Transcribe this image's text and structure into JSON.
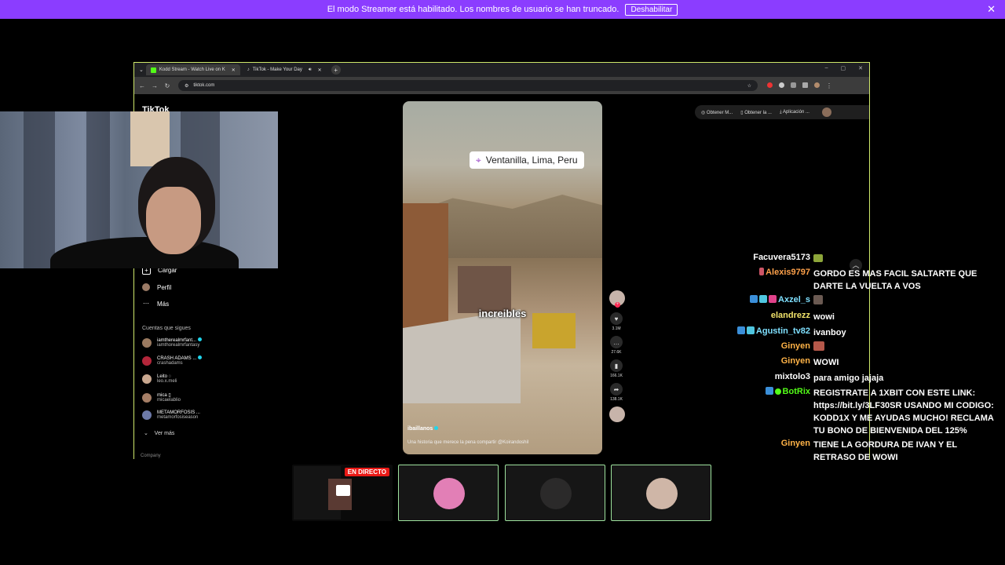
{
  "banner": {
    "text": "El modo Streamer está habilitado. Los nombres de usuario se han truncado.",
    "button": "Deshabilitar"
  },
  "browser": {
    "tabs": [
      {
        "label": "Kodd Stream - Watch Live on K",
        "favicon_color": "#53fc18"
      },
      {
        "label": "TikTok - Make Your Day",
        "favicon_color": "#ffffff"
      }
    ],
    "url": "tiktok.com"
  },
  "tiktok": {
    "logo": "TikTok",
    "menu": [
      {
        "label": "Cargar",
        "icon": "plus-square-icon"
      },
      {
        "label": "Perfil",
        "icon": "avatar-icon"
      },
      {
        "label": "Más",
        "icon": "more-icon"
      }
    ],
    "following_header": "Cuentas que sigues",
    "following": [
      {
        "name": "iamtherealmrfant...",
        "handle": "iamthorealmrfantasy",
        "verified": true,
        "color": "#9a7a60"
      },
      {
        "name": "CRASH ADAMS ...",
        "handle": "crashadams",
        "verified": true,
        "color": "#b3263a"
      },
      {
        "name": "Leito ◌",
        "handle": "leo.x.meli",
        "verified": false,
        "color": "#c9a78f"
      },
      {
        "name": "mica ▯",
        "handle": "micaelablio",
        "verified": false,
        "color": "#a57e66"
      },
      {
        "name": "METAMORFOSIS ...",
        "handle": "metamorfosiseason",
        "verified": false,
        "color": "#6d7aa8"
      }
    ],
    "see_more": "Ver más",
    "company": "Company",
    "top_pills": [
      "Obtener M...",
      "Obtener la ...",
      "Aplicación ..."
    ],
    "video": {
      "location": "Ventanilla, Lima, Peru",
      "caption": "increibles",
      "author": "ibaillanos",
      "description": "Una historia que merece la pena compartir @Koirandoshil"
    },
    "actions": [
      {
        "icon": "heart-icon",
        "count": "3.1M"
      },
      {
        "icon": "comment-icon",
        "count": "27.6K"
      },
      {
        "icon": "bookmark-icon",
        "count": "166.1K"
      },
      {
        "icon": "share-icon",
        "count": "138.1K"
      }
    ]
  },
  "chat": [
    {
      "user": "Facuvera5173",
      "color": "#ffffff",
      "text": ""
    },
    {
      "user": "Alexis9797",
      "color": "#ffa14a",
      "text": "GORDO ES MAS FACIL SALTARTE QUE DARTE LA VUELTA A VOS"
    },
    {
      "user": "Axzel_s",
      "color": "#7fe0ff",
      "text": ""
    },
    {
      "user": "elandrezz",
      "color": "#f2e46b",
      "text": "wowi"
    },
    {
      "user": "Agustin_tv82",
      "color": "#7fe0ff",
      "text": "ivanboy"
    },
    {
      "user": "Ginyen",
      "color": "#ffb347",
      "text": ""
    },
    {
      "user": "Ginyen",
      "color": "#ffb347",
      "text": "WOWI"
    },
    {
      "user": "mixtolo3",
      "color": "#ffffff",
      "text": "para amigo jajaja"
    },
    {
      "user": "BotRix",
      "color": "#53fc18",
      "text": "REGISTRATE A 1XBIT CON ESTE LINK: https://bit.ly/3LF30SR USANDO MI CODIGO: KODD1X Y ME AYUDAS MUCHO! RECLAMA TU BONO DE BIENVENIDA DEL 125%"
    },
    {
      "user": "Ginyen",
      "color": "#ffb347",
      "text": "TIENE LA GORDURA DE IVAN Y EL RETRASO DE WOWI"
    }
  ],
  "thumbnails": {
    "live_label": "EN DIRECTO"
  }
}
